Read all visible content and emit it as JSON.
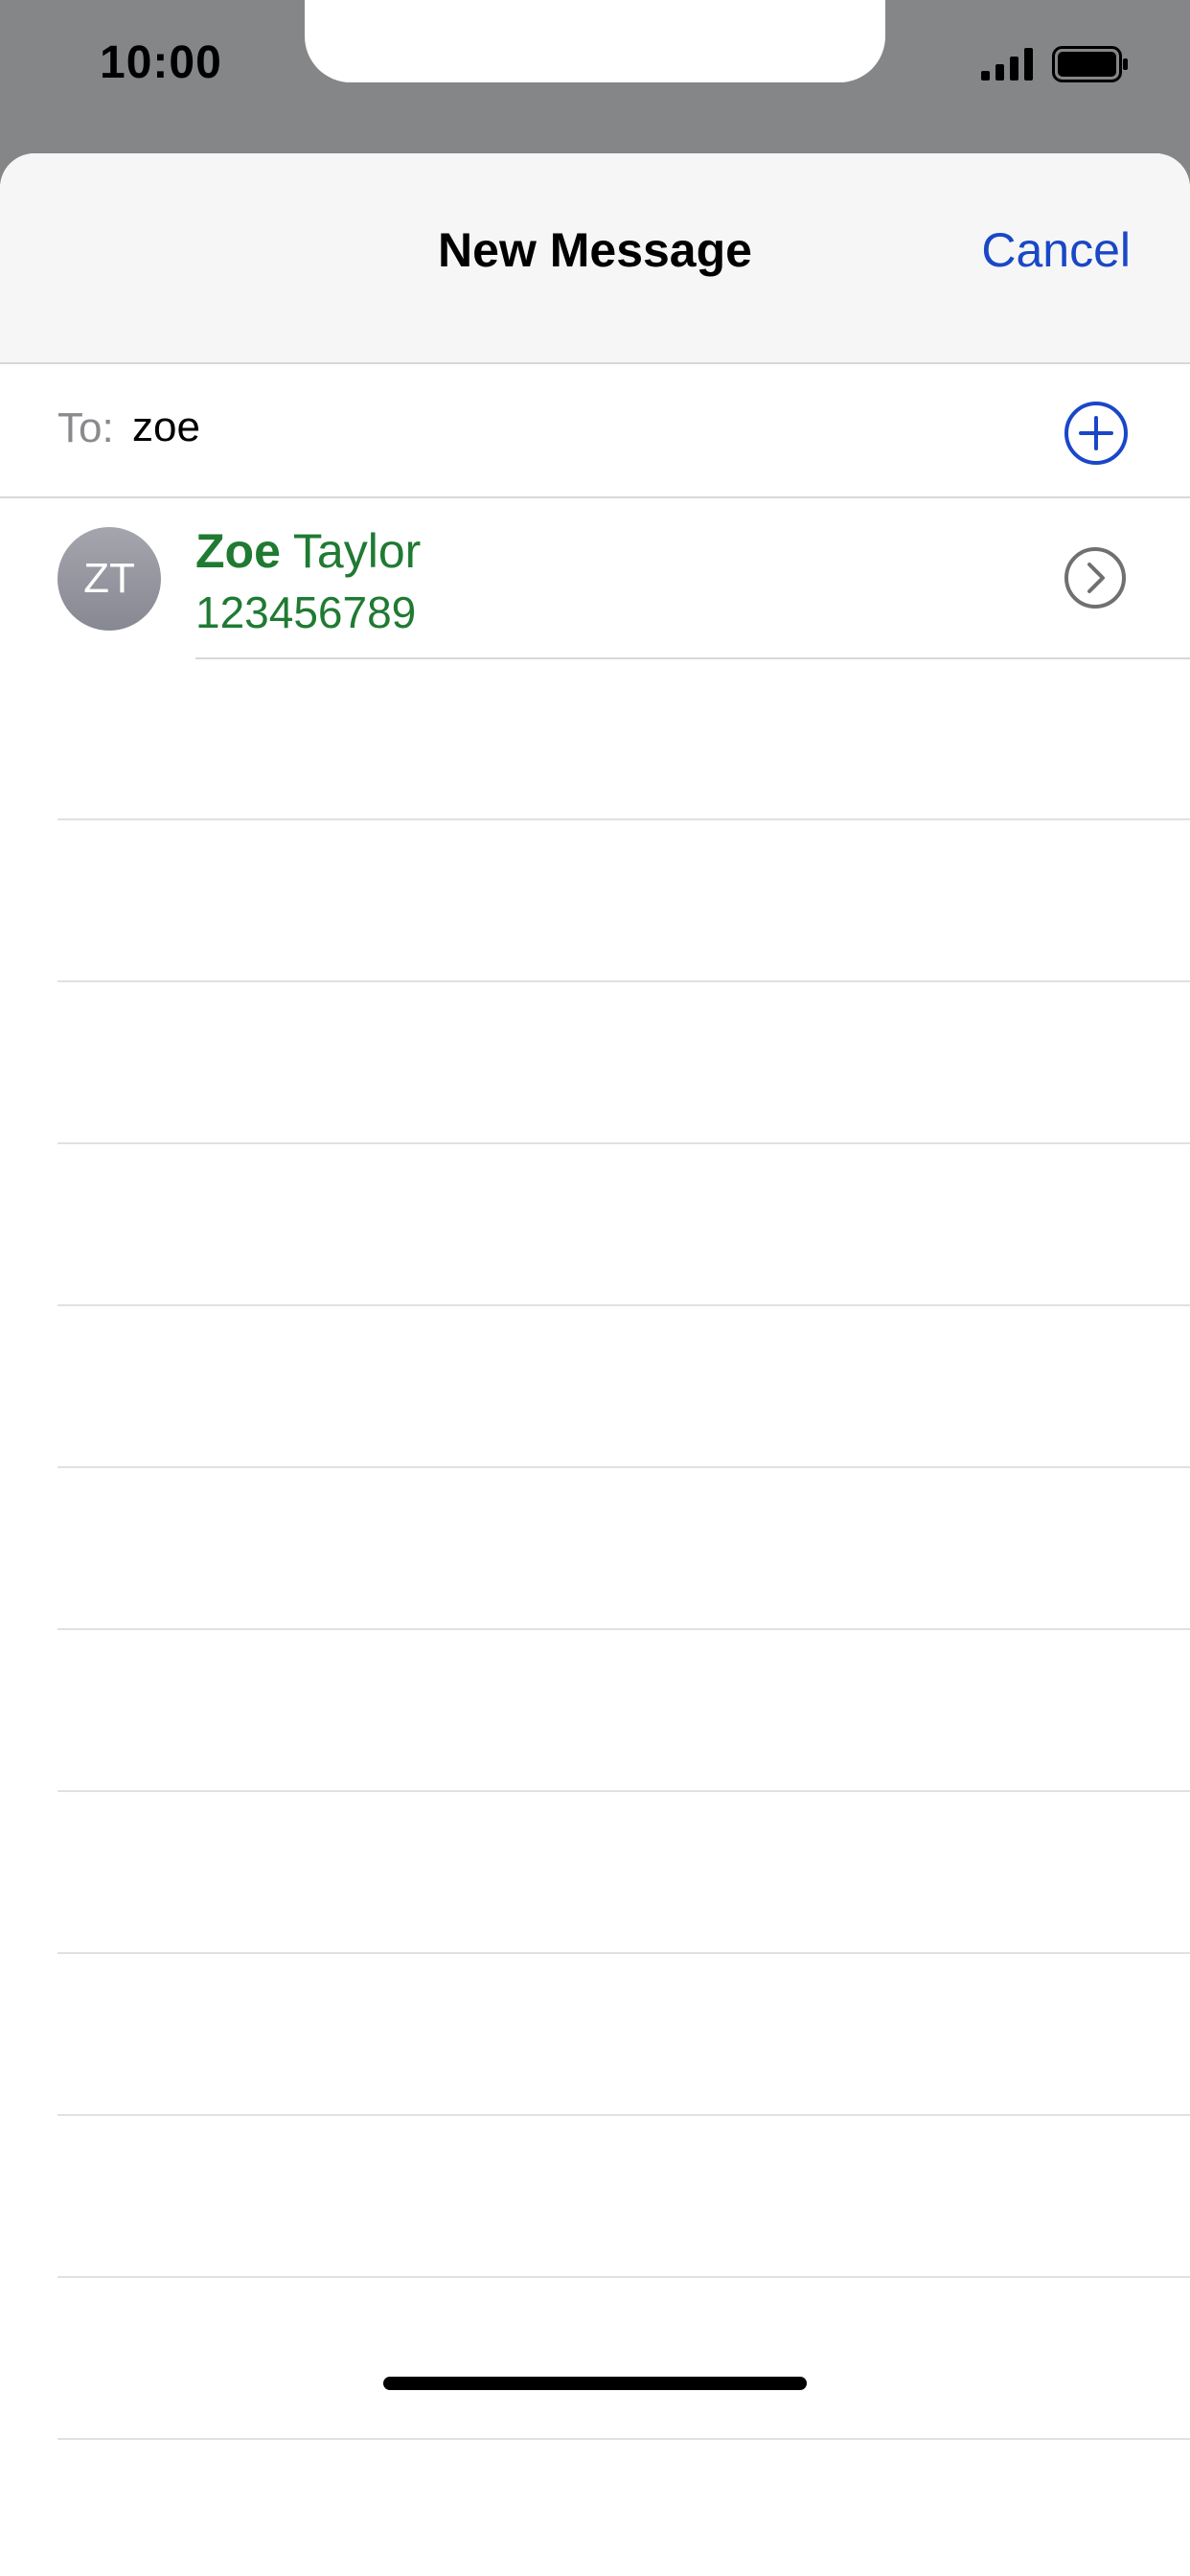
{
  "status_bar": {
    "time": "10:00",
    "signal_icon": "cellular-signal-icon",
    "battery_icon": "battery-full-icon"
  },
  "nav": {
    "title": "New Message",
    "cancel_label": "Cancel"
  },
  "compose": {
    "to_label": "To:",
    "to_value": "zoe",
    "add_icon": "add-contact-plus-icon"
  },
  "results": [
    {
      "initials": "ZT",
      "first_name": "Zoe",
      "last_name": "Taylor",
      "phone": "123456789",
      "info_icon": "chevron-right-circle-icon"
    }
  ],
  "colors": {
    "accent": "#1a47c7",
    "match_green": "#1f7a32",
    "secondary_text": "#8a8a8e",
    "status_bar_bg": "#858688"
  }
}
